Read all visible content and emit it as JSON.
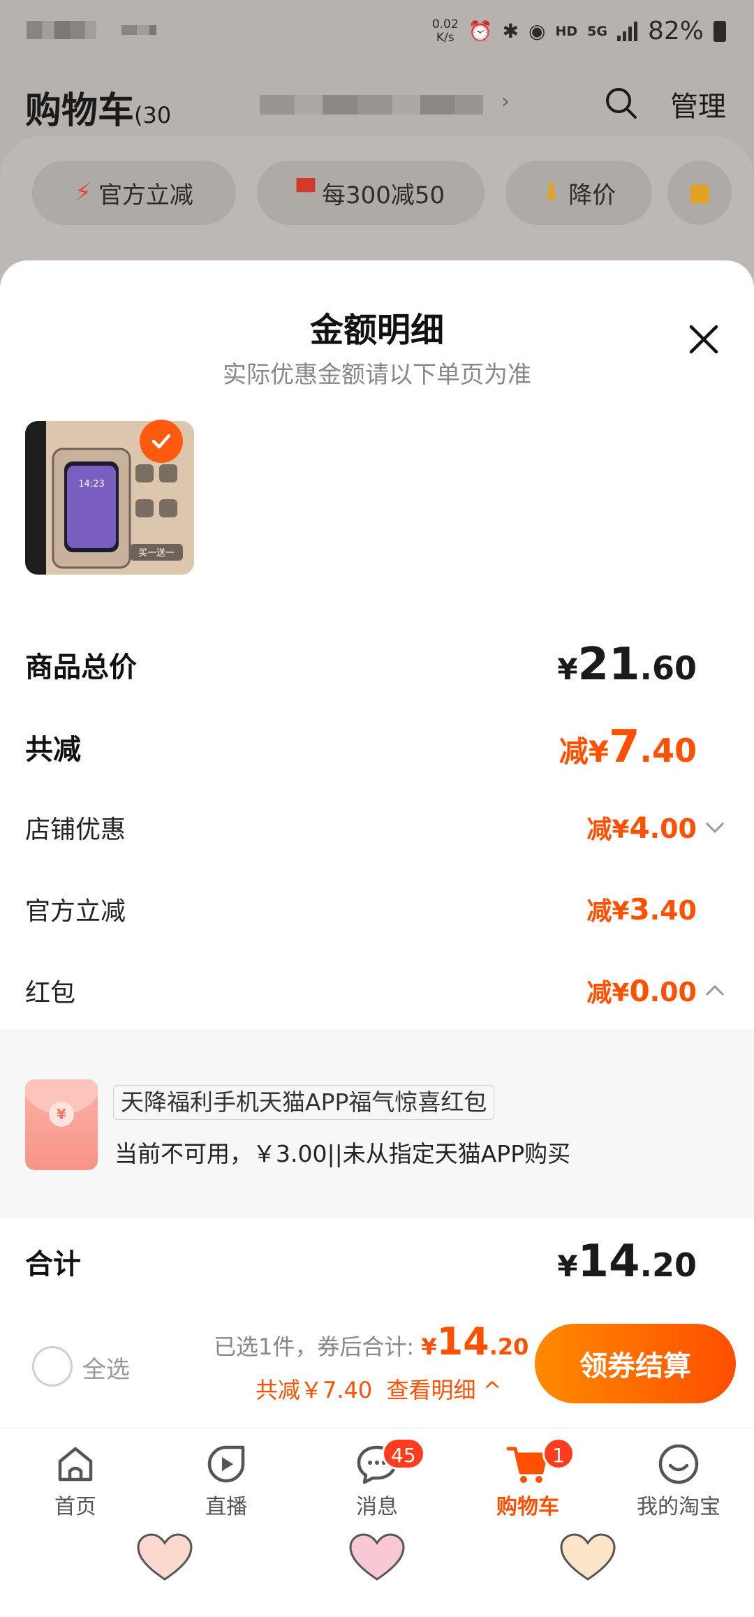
{
  "status_bar": {
    "net_speed_value": "0.02",
    "net_speed_unit": "K/s",
    "hd_label": "HD",
    "network_label": "5G",
    "battery": "82%"
  },
  "header": {
    "title": "购物车",
    "count": "(30",
    "manage": "管理"
  },
  "filter_chips": [
    {
      "label": "官方立减",
      "icon": "lightning-icon"
    },
    {
      "label": "每300减50",
      "icon": "shop-icon"
    },
    {
      "label": "降价",
      "icon": "price-drop-icon"
    },
    {
      "label": "",
      "icon": "folder-icon"
    }
  ],
  "sheet": {
    "title": "金额明细",
    "subtitle": "实际优惠金额请以下单页为准"
  },
  "product": {
    "thumb_time": "14:23",
    "thumb_tag": "买一送一"
  },
  "rows": {
    "total_price": {
      "label": "商品总价",
      "sym": "¥",
      "int": "21",
      "dec": ".60"
    },
    "total_discount": {
      "label": "共减",
      "sym": "减¥",
      "int": "7",
      "dec": ".40"
    },
    "shop_discount": {
      "label": "店铺优惠",
      "sym": "减¥",
      "int": "4",
      "dec": ".00"
    },
    "official_discount": {
      "label": "官方立减",
      "sym": "减¥",
      "int": "3",
      "dec": ".40"
    },
    "red_packet": {
      "label": "红包",
      "sym": "减¥",
      "int": "0",
      "dec": ".00"
    },
    "subtotal": {
      "label": "合计",
      "sym": "¥",
      "int": "14",
      "dec": ".20"
    }
  },
  "red_packet_item": {
    "coin": "¥",
    "name": "天降福利手机天猫APP福气惊喜红包",
    "desc": "当前不可用，￥3.00||未从指定天猫APP购买"
  },
  "checkout": {
    "select_all": "全选",
    "selected_text": "已选1件，券后合计:",
    "total_sym": "¥",
    "total_int": "14",
    "total_dec": ".20",
    "discount_text": "共减￥7.40",
    "detail_link": "查看明细",
    "button": "领券结算"
  },
  "tabbar": [
    {
      "label": "首页",
      "icon": "home-icon",
      "badge": ""
    },
    {
      "label": "直播",
      "icon": "live-icon",
      "badge": ""
    },
    {
      "label": "消息",
      "icon": "message-icon",
      "badge": "45"
    },
    {
      "label": "购物车",
      "icon": "cart-icon",
      "badge": "1"
    },
    {
      "label": "我的淘宝",
      "icon": "profile-icon",
      "badge": ""
    }
  ],
  "colors": {
    "accent": "#ff5000",
    "button_start": "#ff8a00",
    "button_end": "#ff4e00",
    "badge": "#ff3c1e"
  }
}
